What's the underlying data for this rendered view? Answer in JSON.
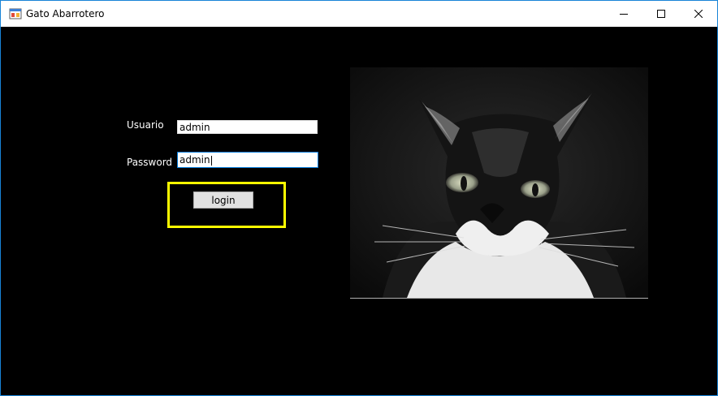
{
  "window": {
    "title": "Gato Abarrotero",
    "icon": "app-window-icon",
    "controls": {
      "minimize": "minimize-icon",
      "maximize": "maximize-icon",
      "close": "close-icon"
    },
    "border_color": "#1883d7"
  },
  "form": {
    "user_label": "Usuario",
    "user_value": "admin",
    "password_label": "Password",
    "password_value": "admin",
    "login_label": "login",
    "highlight_color": "#ffff00",
    "background_color": "#000000"
  },
  "image": {
    "subject": "black-and-white-cat-photo"
  }
}
